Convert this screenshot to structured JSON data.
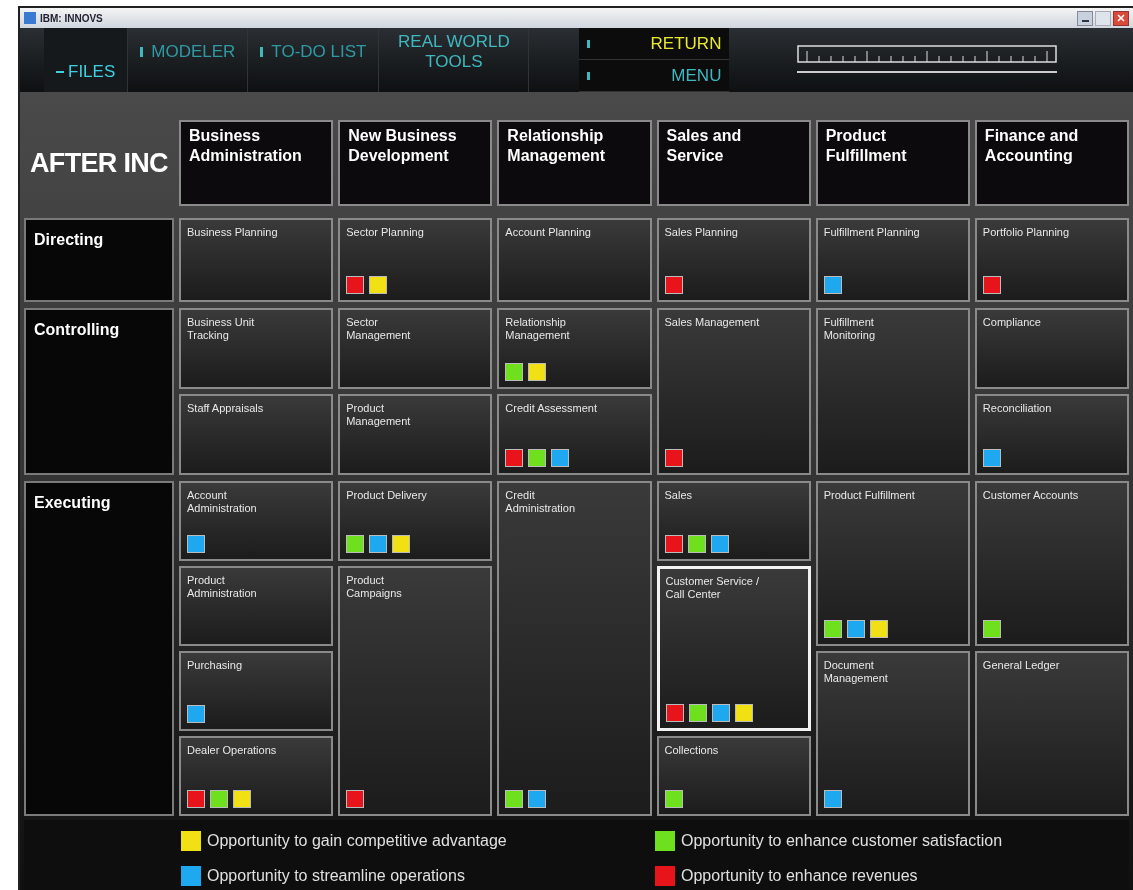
{
  "window": {
    "title": "IBM: INNOVS"
  },
  "nav": [
    {
      "label": "FILES",
      "kind": "dash",
      "selected": true
    },
    {
      "label": "MODELER",
      "kind": "bar",
      "selected": false
    },
    {
      "label": "TO-DO LIST",
      "kind": "bar",
      "selected": false
    },
    {
      "label": "REAL WORLD TOOLS",
      "kind": "plain",
      "selected": false
    }
  ],
  "side_nav": [
    {
      "label": "RETURN",
      "highlighted": true
    },
    {
      "label": "MENU",
      "highlighted": false
    }
  ],
  "company": "AFTER INC",
  "columns": [
    {
      "title": "Business Administration",
      "stages": [
        [
          {
            "name": "Business Planning",
            "selected": false
          }
        ],
        [
          {
            "name": "Business Unit Tracking",
            "selected": false
          },
          {
            "name": "Staff Appraisals",
            "selected": false
          }
        ],
        [
          {
            "name": "Account Administration",
            "selected": false,
            "markers": [
              {
                "color": "#1ea8f0"
              }
            ]
          },
          {
            "name": "Product Administration",
            "selected": false
          },
          {
            "name": "Purchasing",
            "selected": false,
            "markers": [
              {
                "color": "#1ea8f0"
              }
            ]
          },
          {
            "name": "Dealer Operations",
            "selected": false,
            "markers": [
              {
                "color": "#e8141c"
              },
              {
                "color": "#6ee01e"
              },
              {
                "color": "#f0e014"
              }
            ]
          }
        ]
      ]
    },
    {
      "title": "New Business Development",
      "stages": [
        [
          {
            "name": "Sector Planning",
            "selected": false,
            "markers": [
              {
                "color": "#e8141c"
              },
              {
                "color": "#f0e014"
              }
            ]
          }
        ],
        [
          {
            "name": "Sector Management",
            "selected": false
          },
          {
            "name": "Product Management",
            "selected": false
          }
        ],
        [
          {
            "name": "Product Delivery",
            "selected": false,
            "markers": [
              {
                "color": "#6ee01e"
              },
              {
                "color": "#1ea8f0"
              },
              {
                "color": "#f0e014"
              }
            ]
          },
          {
            "name": "Product Campaigns",
            "selected": false,
            "rowspan": 3,
            "markers": [
              {
                "color": "#e8141c"
              }
            ]
          }
        ]
      ]
    },
    {
      "title": "Relationship Management",
      "stages": [
        [
          {
            "name": "Account Planning",
            "selected": false
          }
        ],
        [
          {
            "name": "Relationship Management",
            "selected": false,
            "markers": [
              {
                "color": "#6ee01e"
              },
              {
                "color": "#f0e014"
              }
            ]
          },
          {
            "name": "Credit Assessment",
            "selected": false,
            "markers": [
              {
                "color": "#e8141c"
              },
              {
                "color": "#6ee01e"
              },
              {
                "color": "#1ea8f0"
              }
            ]
          }
        ],
        [
          {
            "name": "Credit Administration",
            "selected": false,
            "rowspan": 4,
            "markers": [
              {
                "color": "#6ee01e"
              },
              {
                "color": "#1ea8f0"
              }
            ]
          }
        ]
      ]
    },
    {
      "title": "Sales and Service",
      "stages": [
        [
          {
            "name": "Sales Planning",
            "selected": false,
            "markers": [
              {
                "color": "#e8141c"
              }
            ]
          }
        ],
        [
          {
            "name": "Sales Management",
            "selected": false,
            "rowspan": 2,
            "markers": [
              {
                "color": "#e8141c"
              }
            ]
          }
        ],
        [
          {
            "name": "Sales",
            "selected": false,
            "markers": [
              {
                "color": "#e8141c"
              },
              {
                "color": "#6ee01e"
              },
              {
                "color": "#1ea8f0"
              }
            ]
          },
          {
            "name": "Customer Service / Call Center",
            "selected": true,
            "rowspan": 2,
            "markers": [
              {
                "color": "#e8141c"
              },
              {
                "color": "#6ee01e"
              },
              {
                "color": "#1ea8f0"
              },
              {
                "color": "#f0e014"
              }
            ]
          },
          {
            "name": "Collections",
            "selected": false,
            "markers": [
              {
                "color": "#6ee01e"
              }
            ]
          }
        ]
      ]
    },
    {
      "title": "Product Fulfillment",
      "stages": [
        [
          {
            "name": "Fulfillment Planning",
            "selected": false,
            "markers": [
              {
                "color": "#1ea8f0"
              }
            ]
          }
        ],
        [
          {
            "name": "Fulfillment Monitoring",
            "selected": false,
            "rowspan": 2
          }
        ],
        [
          {
            "name": "Product Fulfillment",
            "selected": false,
            "rowspan": 2,
            "markers": [
              {
                "color": "#6ee01e"
              },
              {
                "color": "#1ea8f0"
              },
              {
                "color": "#f0e014"
              }
            ]
          },
          {
            "name": "Document Management",
            "selected": false,
            "rowspan": 2,
            "markers": [
              {
                "color": "#1ea8f0"
              }
            ]
          }
        ]
      ]
    },
    {
      "title": "Finance and Accounting",
      "stages": [
        [
          {
            "name": "Portfolio Planning",
            "selected": false,
            "markers": [
              {
                "color": "#e8141c"
              }
            ]
          }
        ],
        [
          {
            "name": "Compliance",
            "selected": false
          },
          {
            "name": "Reconciliation",
            "selected": false,
            "markers": [
              {
                "color": "#1ea8f0"
              }
            ]
          }
        ],
        [
          {
            "name": "Customer Accounts",
            "selected": false,
            "rowspan": 2,
            "markers": [
              {
                "color": "#6ee01e"
              }
            ]
          },
          {
            "name": "General Ledger",
            "selected": false,
            "rowspan": 2
          }
        ]
      ]
    }
  ],
  "stages": [
    "Directing",
    "Controlling",
    "Executing"
  ],
  "legend": [
    {
      "label": "Opportunity to gain competitive advantage",
      "color": "#f0e014"
    },
    {
      "label": "Opportunity to enhance customer satisfaction",
      "color": "#6ee01e"
    },
    {
      "label": "Opportunity to streamline operations",
      "color": "#1ea8f0"
    },
    {
      "label": "Opportunity to enhance revenues",
      "color": "#e8141c"
    }
  ]
}
